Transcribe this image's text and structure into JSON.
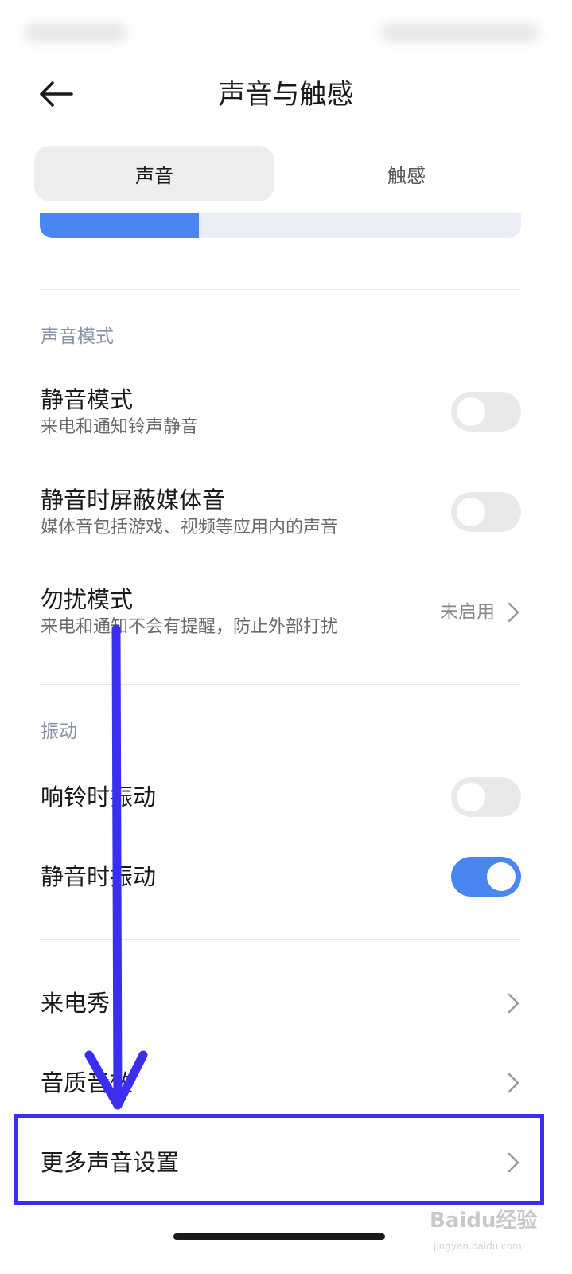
{
  "header": {
    "title": "声音与触感"
  },
  "tabs": [
    {
      "label": "声音",
      "active": true
    },
    {
      "label": "触感",
      "active": false
    }
  ],
  "volume": {
    "level": 0.33,
    "fill_color": "#4a86f0"
  },
  "sections": {
    "sound_mode": {
      "label": "声音模式",
      "items": [
        {
          "title": "静音模式",
          "subtitle": "来电和通知铃声静音",
          "toggle": false
        },
        {
          "title": "静音时屏蔽媒体音",
          "subtitle": "媒体音包括游戏、视频等应用内的声音",
          "toggle": false
        },
        {
          "title": "勿扰模式",
          "subtitle": "来电和通知不会有提醒，防止外部打扰",
          "value": "未启用"
        }
      ]
    },
    "vibration": {
      "label": "振动",
      "items": [
        {
          "title": "响铃时振动",
          "toggle": false
        },
        {
          "title": "静音时振动",
          "toggle": true
        }
      ]
    },
    "other": {
      "items": [
        {
          "title": "来电秀"
        },
        {
          "title": "音质音效"
        },
        {
          "title": "更多声音设置"
        }
      ]
    }
  },
  "annotation": {
    "color": "#3a2ff0"
  },
  "watermark": {
    "text": "Baidu经验",
    "sub": "jingyan.baidu.com"
  }
}
